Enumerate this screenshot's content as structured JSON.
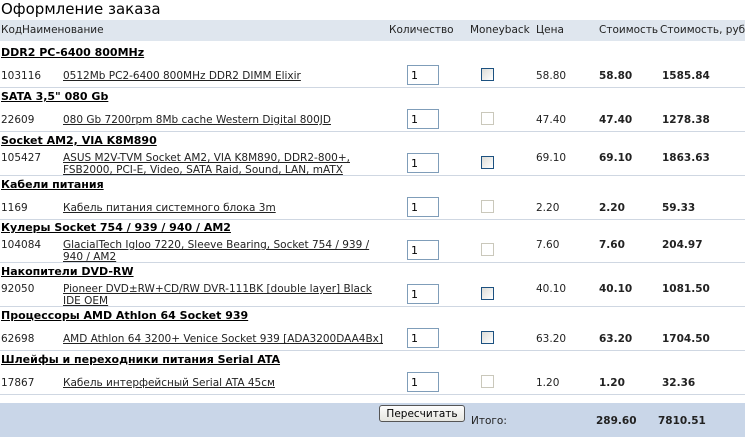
{
  "page": {
    "title": "Оформление заказа"
  },
  "headers": {
    "code": "Код",
    "name": "Наименование",
    "qty": "Количество",
    "moneyback": "Moneyback",
    "price": "Цена",
    "cost": "Стоимость",
    "cost_rub": "Стоимость, руб."
  },
  "groups": [
    {
      "category": "DDR2 PC-6400 800MHz",
      "item": {
        "code": "103116",
        "name": "0512Mb PC2-6400 800MHz DDR2 DIMM Elixir",
        "qty": "1",
        "moneyback": true,
        "price": "58.80",
        "cost": "58.80",
        "cost_rub": "1585.84"
      }
    },
    {
      "category": "SATA 3,5\" 080 Gb",
      "item": {
        "code": "22609",
        "name": "080 Gb 7200rpm 8Mb cache Western Digital 800JD",
        "qty": "1",
        "moneyback": false,
        "price": "47.40",
        "cost": "47.40",
        "cost_rub": "1278.38"
      }
    },
    {
      "category": "Socket AM2, VIA K8M890",
      "item": {
        "code": "105427",
        "name": "ASUS M2V-TVM Socket AM2, VIA K8M890, DDR2-800+, FSB2000, PCI-E, Video, SATA Raid, Sound, LAN, mATX",
        "qty": "1",
        "moneyback": true,
        "price": "69.10",
        "cost": "69.10",
        "cost_rub": "1863.63"
      }
    },
    {
      "category": "Кабели питания",
      "item": {
        "code": "1169",
        "name": "Кабель питания системного блока 3m",
        "qty": "1",
        "moneyback": false,
        "price": "2.20",
        "cost": "2.20",
        "cost_rub": "59.33"
      }
    },
    {
      "category": "Кулеры Socket 754 / 939 / 940 / AM2",
      "item": {
        "code": "104084",
        "name": "GlacialTech Igloo 7220, Sleeve Bearing, Socket 754 / 939 / 940 / AM2",
        "qty": "1",
        "moneyback": false,
        "price": "7.60",
        "cost": "7.60",
        "cost_rub": "204.97"
      }
    },
    {
      "category": "Накопители DVD-RW",
      "item": {
        "code": "92050",
        "name": "Pioneer DVD±RW+CD/RW DVR-111BK [double layer] Black IDE OEM",
        "qty": "1",
        "moneyback": true,
        "price": "40.10",
        "cost": "40.10",
        "cost_rub": "1081.50"
      }
    },
    {
      "category": "Процессоры AMD Athlon 64 Socket 939",
      "item": {
        "code": "62698",
        "name": "AMD Athlon 64 3200+ Venice Socket 939 [ADA3200DAA4Bx]",
        "qty": "1",
        "moneyback": true,
        "price": "63.20",
        "cost": "63.20",
        "cost_rub": "1704.50"
      }
    },
    {
      "category": "Шлейфы и переходники питания Serial ATA",
      "item": {
        "code": "17867",
        "name": "Кабель интерфейсный Serial ATA 45см",
        "qty": "1",
        "moneyback": false,
        "price": "1.20",
        "cost": "1.20",
        "cost_rub": "32.36"
      }
    }
  ],
  "footer": {
    "recalc_label": "Пересчитать",
    "total_label": "Итого:",
    "total": "289.60",
    "total_rub": "7810.51"
  },
  "colors": {
    "header_bg": "#dfe6ee",
    "footer_bg": "#c9d6e8",
    "row_line": "#cfd7e2"
  }
}
